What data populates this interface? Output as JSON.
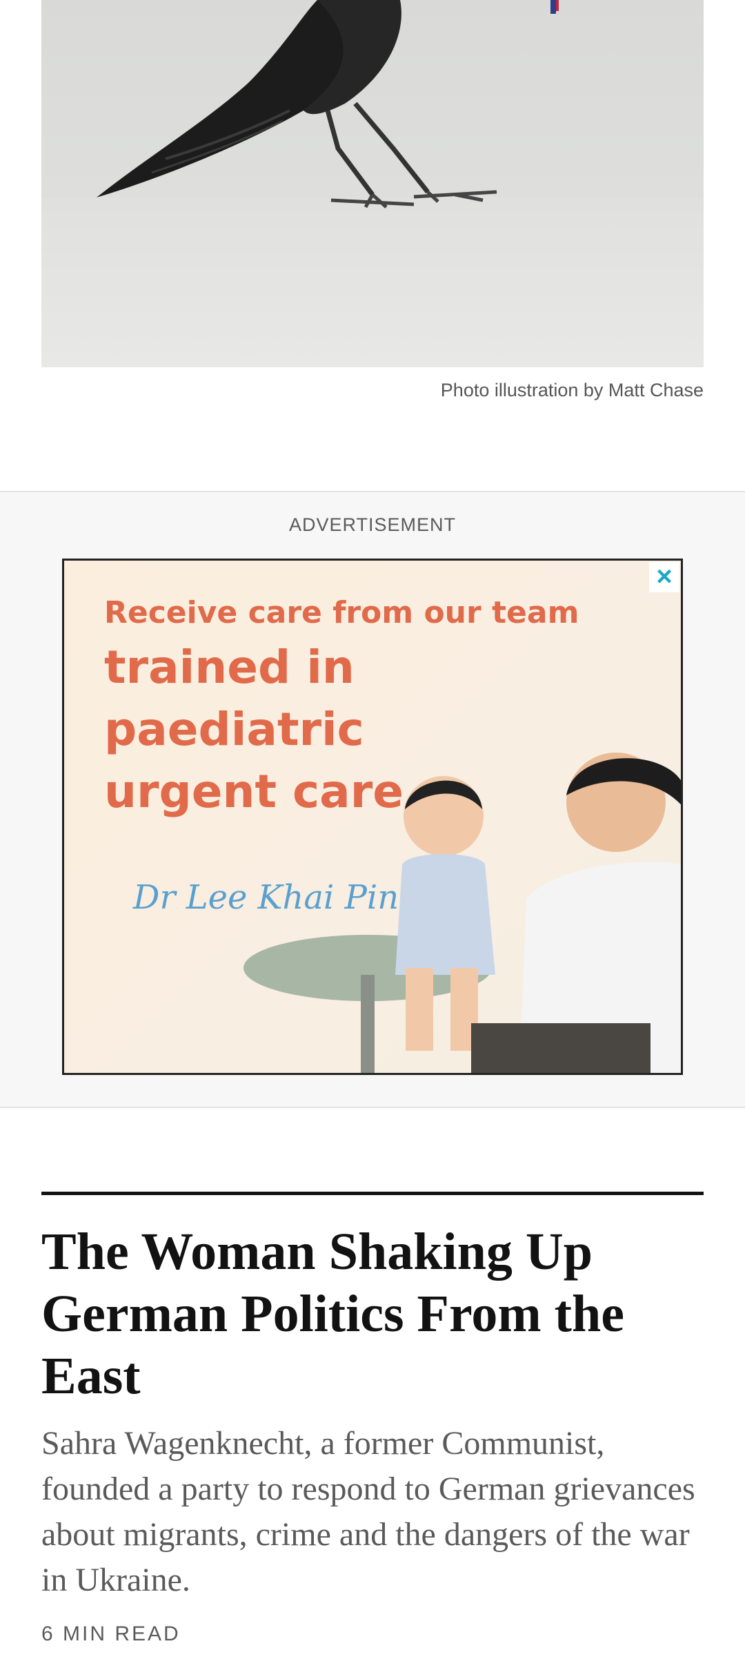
{
  "hero": {
    "caption": "Photo illustration by Matt Chase",
    "image_name": "crow-photo-illustration"
  },
  "ad": {
    "label": "ADVERTISEMENT",
    "line1": "Receive care from our team",
    "line2": "trained in paediatric urgent care.",
    "signature": "Dr Lee Khai Pin",
    "close_icon": "close-icon",
    "accent_color": "#e06a4a",
    "close_color": "#1ba7c7"
  },
  "article": {
    "headline": "The Woman Shaking Up German Politics From the East",
    "summary": "Sahra Wagenknecht, a former Communist, founded a party to respond to German grievances about migrants, crime and the dangers of the war in Ukraine.",
    "read_time": "6 MIN READ"
  }
}
